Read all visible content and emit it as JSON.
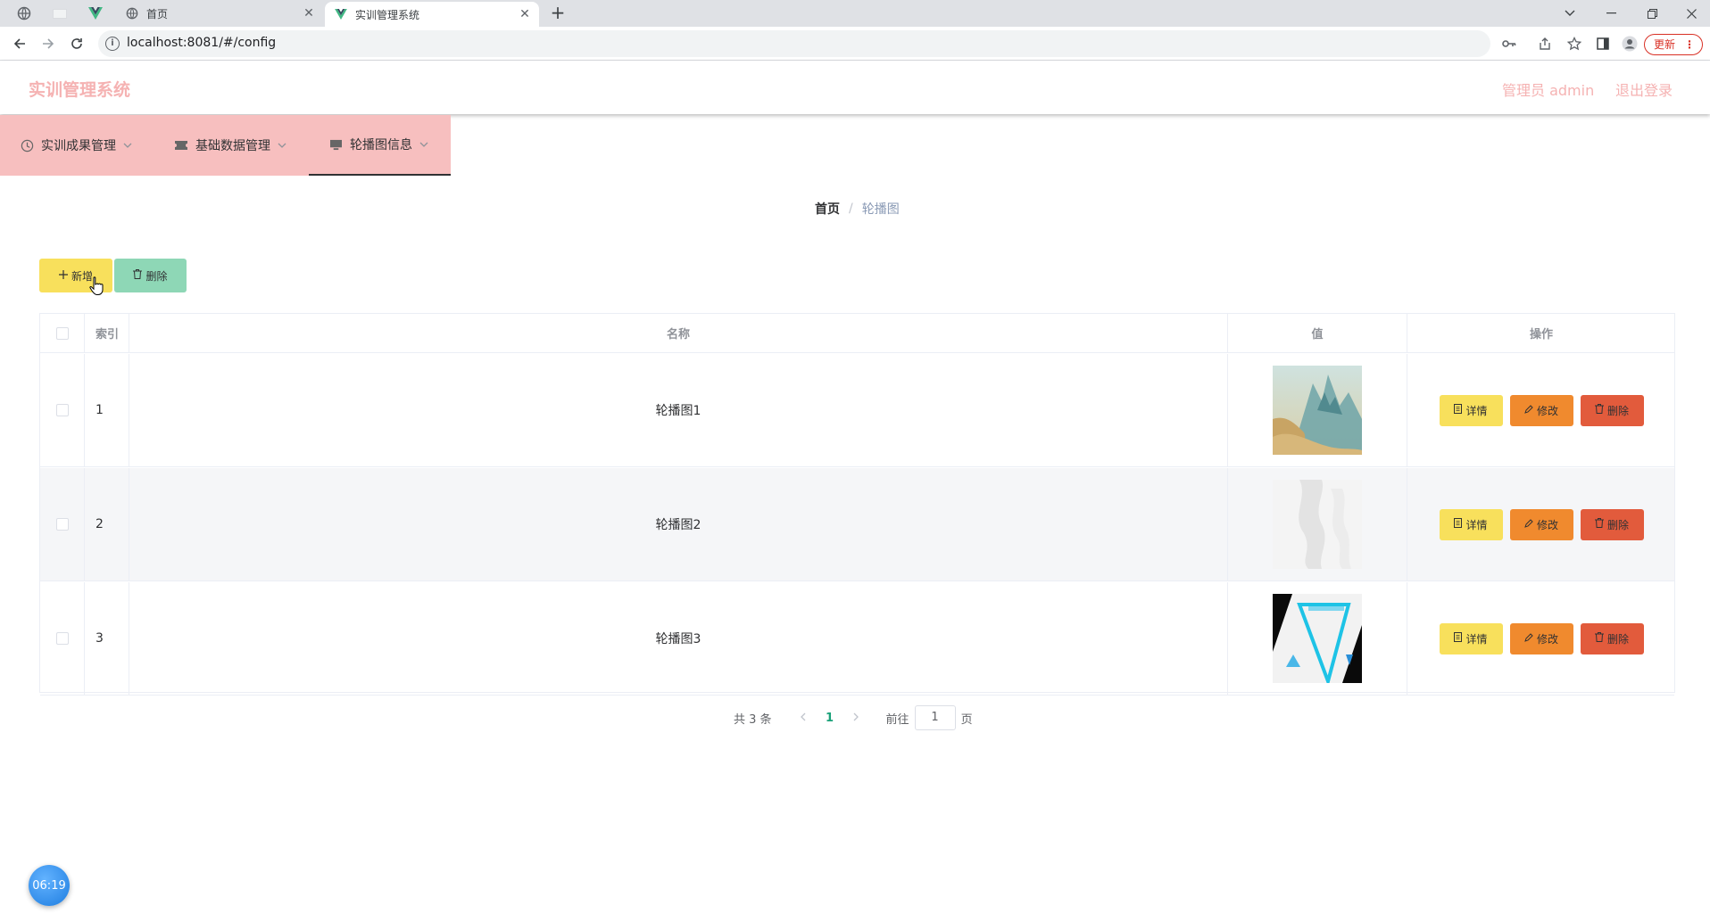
{
  "browser": {
    "tabs": [
      {
        "title": "首页"
      },
      {
        "title": "实训管理系统"
      }
    ],
    "url": "localhost:8081/#/config",
    "update_label": "更新",
    "close_glyph": "✕",
    "newtab_glyph": "+"
  },
  "header": {
    "title": "实训管理系统",
    "user": "管理员 admin",
    "logout": "退出登录"
  },
  "menu": {
    "items": [
      {
        "label": "实训成果管理",
        "icon": "clock-icon"
      },
      {
        "label": "基础数据管理",
        "icon": "ticket-icon"
      },
      {
        "label": "轮播图信息",
        "icon": "monitor-icon"
      }
    ],
    "active_index": 2
  },
  "breadcrumb": {
    "home": "首页",
    "separator": "/",
    "current": "轮播图"
  },
  "toolbar": {
    "add_label": "新增",
    "delete_label": "删除"
  },
  "table": {
    "columns": [
      "索引",
      "名称",
      "值",
      "操作"
    ],
    "rows": [
      {
        "index": "1",
        "name": "轮播图1",
        "image": "landscape-painting"
      },
      {
        "index": "2",
        "name": "轮播图2",
        "image": "grey-texture"
      },
      {
        "index": "3",
        "name": "轮播图3",
        "image": "abstract-triangle"
      }
    ],
    "actions": {
      "detail": "详情",
      "edit": "修改",
      "remove": "删除"
    }
  },
  "pagination": {
    "total_text": "共 3 条",
    "current_page": "1",
    "goto_prefix": "前往",
    "goto_value": "1",
    "goto_suffix": "页"
  },
  "clock": {
    "time": "06:19"
  },
  "colors": {
    "brand_pink": "#f5b2b2",
    "menu_bg": "#f7bfbf",
    "btn_yellow": "#f8e05c",
    "btn_green": "#8ed7b6",
    "btn_orange": "#f08a2e",
    "btn_red": "#e25b3c",
    "page_active": "#1aa179"
  }
}
